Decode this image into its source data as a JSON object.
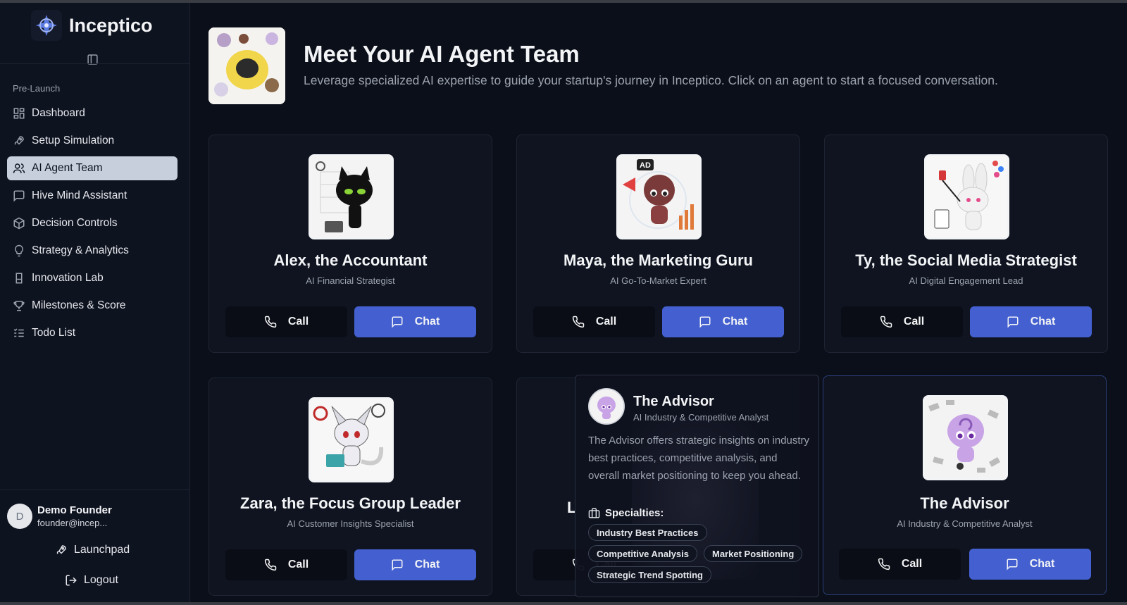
{
  "app": {
    "name": "Inceptico"
  },
  "sidebar": {
    "group_label": "Pre-Launch",
    "items": [
      {
        "label": "Dashboard",
        "icon": "grid-icon",
        "active": false
      },
      {
        "label": "Setup Simulation",
        "icon": "rocket-icon",
        "active": false
      },
      {
        "label": "AI Agent Team",
        "icon": "users-icon",
        "active": true
      },
      {
        "label": "Hive Mind Assistant",
        "icon": "message-square-icon",
        "active": false
      },
      {
        "label": "Decision Controls",
        "icon": "box-icon",
        "active": false
      },
      {
        "label": "Strategy & Analytics",
        "icon": "lightbulb-icon",
        "active": false
      },
      {
        "label": "Innovation Lab",
        "icon": "beaker-icon",
        "active": false
      },
      {
        "label": "Milestones & Score",
        "icon": "trophy-icon",
        "active": false
      },
      {
        "label": "Todo List",
        "icon": "list-todo-icon",
        "active": false
      }
    ],
    "user": {
      "initial": "D",
      "name": "Demo Founder",
      "email": "founder@incep..."
    },
    "launchpad_label": "Launchpad",
    "logout_label": "Logout"
  },
  "header": {
    "title": "Meet Your AI Agent Team",
    "subtitle": "Leverage specialized AI expertise to guide your startup's journey in Inceptico. Click on an agent to start a focused conversation."
  },
  "buttons": {
    "call": "Call",
    "chat": "Chat"
  },
  "agents": [
    {
      "name": "Alex, the Accountant",
      "role": "AI Financial Strategist"
    },
    {
      "name": "Maya, the Marketing Guru",
      "role": "AI Go-To-Market Expert"
    },
    {
      "name": "Ty, the Social Media Strategist",
      "role": "AI Digital Engagement Lead"
    },
    {
      "name": "Zara, the Focus Group Leader",
      "role": "AI Customer Insights Specialist"
    },
    {
      "name": "L",
      "role": ""
    },
    {
      "name": "The Advisor",
      "role": "AI Industry & Competitive Analyst"
    }
  ],
  "popover": {
    "name": "The Advisor",
    "role": "AI Industry & Competitive Analyst",
    "description": "The Advisor offers strategic insights on industry best practices, competitive analysis, and overall market positioning to keep you ahead.",
    "specialties_label": "Specialties:",
    "specialties": [
      "Industry Best Practices",
      "Competitive Analysis",
      "Market Positioning",
      "Strategic Trend Spotting"
    ]
  },
  "colors": {
    "accent": "#4460d0",
    "background": "#0b0f19",
    "active_nav": "#c7cfdc"
  }
}
